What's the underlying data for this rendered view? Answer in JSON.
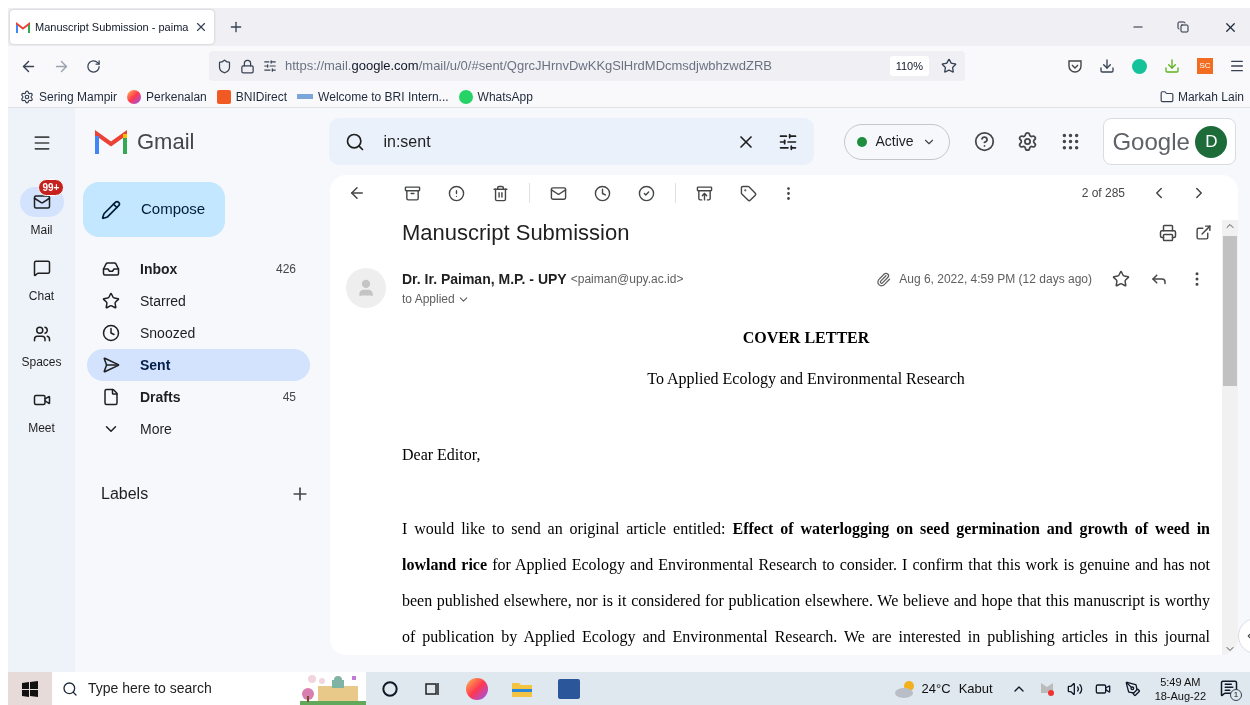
{
  "browser": {
    "tab": {
      "title": "Manuscript Submission - paima",
      "selected": true
    },
    "url": {
      "host_before": "https://mail.",
      "host": "google.com",
      "path": "/mail/u/0/#sent/QgrcJHrnvDwKKgSlHrdMDcmsdjwbhzwdZRB"
    },
    "zoom": "110%",
    "extension_badge": "SC",
    "bookmarks": [
      {
        "kind": "gear",
        "label": "Sering Mampir"
      },
      {
        "kind": "firefox",
        "label": "Perkenalan"
      },
      {
        "kind": "bni",
        "label": "BNIDirect"
      },
      {
        "kind": "bri",
        "label": "Welcome to BRI Intern..."
      },
      {
        "kind": "whatsapp",
        "label": "WhatsApp"
      }
    ],
    "other_bookmarks": "Markah Lain"
  },
  "gmail": {
    "app_name": "Gmail",
    "search": {
      "value": "in:sent"
    },
    "status": "Active",
    "google": "Google",
    "avatar": "D",
    "rail": [
      {
        "kind": "mail",
        "label": "Mail",
        "selected": true,
        "badge": "99+"
      },
      {
        "kind": "chat",
        "label": "Chat",
        "selected": false
      },
      {
        "kind": "spaces",
        "label": "Spaces",
        "selected": false
      },
      {
        "kind": "meet",
        "label": "Meet",
        "selected": false
      }
    ],
    "compose": "Compose",
    "folders": [
      {
        "kind": "inbox",
        "label": "Inbox",
        "count": "426",
        "bold": true,
        "selected": false
      },
      {
        "kind": "starred",
        "label": "Starred",
        "bold": false,
        "selected": false
      },
      {
        "kind": "snoozed",
        "label": "Snoozed",
        "bold": false,
        "selected": false
      },
      {
        "kind": "sent",
        "label": "Sent",
        "bold": true,
        "selected": true
      },
      {
        "kind": "drafts",
        "label": "Drafts",
        "count": "45",
        "bold": true,
        "selected": false
      },
      {
        "kind": "more",
        "label": "More",
        "bold": false,
        "selected": false
      }
    ],
    "labels_heading": "Labels"
  },
  "message": {
    "position": "2 of 285",
    "subject": "Manuscript Submission",
    "sender": "Dr. Ir. Paiman, M.P. - UPY",
    "email": "<paiman@upy.ac.id>",
    "recipient": "to Applied",
    "date": "Aug 6, 2022, 4:59 PM (12 days ago)",
    "body": {
      "heading": "COVER LETTER",
      "subheading": "To Applied Ecology and Environmental Research",
      "greeting": "Dear Editor,",
      "paragraph": "I would like to send an original article entitled: **Effect of waterlogging on seed germination and growth of weed in lowland rice** for Applied Ecology and Environmental Research to consider. I confirm that this work is genuine and has not been published elsewhere, nor is it considered for publication elsewhere. We believe and hope that this manuscript is worthy of publication by Applied Ecology and Environmental Research. We are interested in publishing articles in this journal"
    }
  },
  "taskbar": {
    "search": {
      "placeholder": "Type here to search"
    },
    "temperature": "24°C",
    "weather": "Kabut",
    "time": "5:49 AM",
    "date": "18-Aug-22",
    "notifications": "1"
  }
}
